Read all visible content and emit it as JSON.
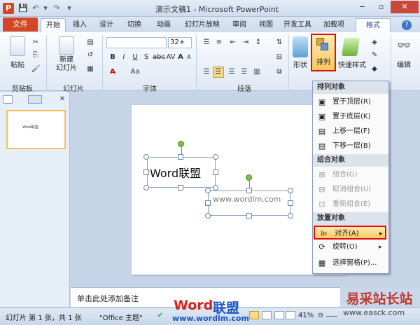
{
  "window": {
    "title": "演示文稿1 - Microsoft PowerPoint",
    "app_icon": "P",
    "controls": {
      "minimize": "−",
      "restore": "▫",
      "close": "✕"
    }
  },
  "qat": {
    "save": "💾",
    "undo": "↶",
    "redo": "↷",
    "customize": "▾"
  },
  "tabs": [
    {
      "label": "文件"
    },
    {
      "label": "开始"
    },
    {
      "label": "插入"
    },
    {
      "label": "设计"
    },
    {
      "label": "切换"
    },
    {
      "label": "动画"
    },
    {
      "label": "幻灯片放映"
    },
    {
      "label": "审阅"
    },
    {
      "label": "视图"
    },
    {
      "label": "开发工具"
    },
    {
      "label": "加载项"
    },
    {
      "label": "格式"
    }
  ],
  "ribbon": {
    "clipboard": {
      "label": "剪贴板",
      "paste": "粘贴"
    },
    "slides": {
      "label": "幻灯片",
      "new_slide": "新建\n幻灯片"
    },
    "font": {
      "label": "字体",
      "size": "32+",
      "bold": "B",
      "italic": "I",
      "underline": "U",
      "strike": "S",
      "shadow": "abc",
      "spacing": "AV",
      "case": "Aa",
      "font_color": "A",
      "grow": "A",
      "shrink": "A"
    },
    "paragraph": {
      "label": "段落"
    },
    "drawing": {
      "shape": "形状",
      "arrange": "排列",
      "quick_styles": "快速样式"
    },
    "editing": {
      "label": "编辑"
    }
  },
  "menu": {
    "arrange_header": "排列对象",
    "bring_front": "置于顶层(R)",
    "send_back": "置于底层(K)",
    "bring_forward": "上移一层(F)",
    "send_backward": "下移一层(B)",
    "group_header": "组合对象",
    "group": "组合(G)",
    "ungroup": "取消组合(U)",
    "regroup": "重新组合(E)",
    "position_header": "放置对象",
    "align": "对齐(A)",
    "rotate": "旋转(O)",
    "selection_pane": "选择窗格(P)..."
  },
  "slide_panel": {
    "slide_number": "1",
    "thumb_text": "Word联盟",
    "close": "✕"
  },
  "slide": {
    "textbox1": "Word联盟",
    "textbox2": "www.wordlm.com"
  },
  "notes_placeholder": "单击此处添加备注",
  "status": {
    "slide_info": "幻灯片 第 1 张，共 1 张",
    "theme": "\"Office 主题\"",
    "zoom": "41%",
    "logo_word": "Word",
    "logo_cn": "联盟",
    "logo_url": "www.wordlm.com"
  },
  "watermark": {
    "text": "易采站长站",
    "url": "www.easck.com"
  }
}
